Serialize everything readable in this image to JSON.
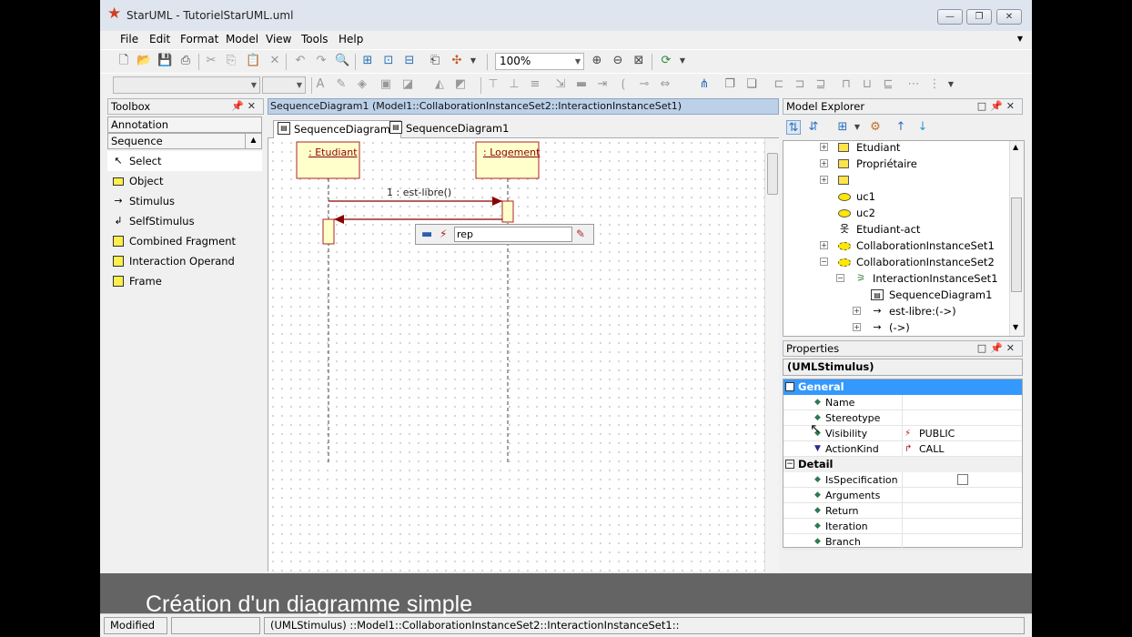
{
  "window": {
    "title": "StarUML - TutorielStarUML.uml",
    "buttons": [
      "minimize",
      "maximize",
      "close"
    ]
  },
  "menu": {
    "items": [
      "File",
      "Edit",
      "Format",
      "Model",
      "View",
      "Tools",
      "Help"
    ]
  },
  "toolbar": {
    "zoom_value": "100%"
  },
  "toolbox": {
    "title": "Toolbox",
    "categories": [
      "Annotation",
      "Sequence"
    ],
    "items": [
      {
        "label": "Select",
        "icon": "cursor-icon",
        "selected": true
      },
      {
        "label": "Object",
        "icon": "object-icon"
      },
      {
        "label": "Stimulus",
        "icon": "arrow-right-icon"
      },
      {
        "label": "SelfStimulus",
        "icon": "self-arrow-icon"
      },
      {
        "label": "Combined Fragment",
        "icon": "fragment-icon"
      },
      {
        "label": "Interaction Operand",
        "icon": "operand-icon"
      },
      {
        "label": "Frame",
        "icon": "frame-icon"
      }
    ]
  },
  "diagram": {
    "path": "SequenceDiagram1 (Model1::CollaborationInstanceSet2::InteractionInstanceSet1)",
    "tabs": [
      "SequenceDiagram1",
      "SequenceDiagram1"
    ],
    "objects": [
      {
        "label": ": Etudiant"
      },
      {
        "label": ": Logement"
      }
    ],
    "messages": [
      {
        "label": "1 : est-libre()"
      }
    ],
    "editor": {
      "value": "rep"
    }
  },
  "explorer": {
    "title": "Model Explorer",
    "nodes": [
      {
        "label": "Etudiant",
        "icon": "class-icon"
      },
      {
        "label": "Propriétaire",
        "icon": "class-icon"
      },
      {
        "label": "",
        "icon": "class-icon"
      },
      {
        "label": "uc1",
        "icon": "usecase-icon"
      },
      {
        "label": "uc2",
        "icon": "usecase-icon"
      },
      {
        "label": "Etudiant-act",
        "icon": "actor-icon"
      },
      {
        "label": "CollaborationInstanceSet1",
        "icon": "collaboration-icon"
      },
      {
        "label": "CollaborationInstanceSet2",
        "icon": "collaboration-icon"
      },
      {
        "label": "InteractionInstanceSet1",
        "icon": "interaction-icon"
      },
      {
        "label": "SequenceDiagram1",
        "icon": "diagram-icon"
      },
      {
        "label": "est-libre:(->)",
        "icon": "stimulus-icon"
      },
      {
        "label": "(->)",
        "icon": "stimulus-icon"
      }
    ]
  },
  "properties": {
    "title": "Properties",
    "type": "(UMLStimulus)",
    "categories": [
      {
        "name": "General",
        "rows": [
          {
            "name": "Name",
            "value": ""
          },
          {
            "name": "Stereotype",
            "value": ""
          },
          {
            "name": "Visibility",
            "value": "PUBLIC"
          },
          {
            "name": "ActionKind",
            "value": "CALL"
          }
        ]
      },
      {
        "name": "Detail",
        "rows": [
          {
            "name": "IsSpecification",
            "value": ""
          },
          {
            "name": "Arguments",
            "value": ""
          },
          {
            "name": "Return",
            "value": ""
          },
          {
            "name": "Iteration",
            "value": ""
          },
          {
            "name": "Branch",
            "value": ""
          }
        ]
      }
    ]
  },
  "statusbar": {
    "mode": "Modified",
    "path": "(UMLStimulus) ::Model1::CollaborationInstanceSet2::InteractionInstanceSet1::"
  },
  "caption": "Création d'un diagramme simple"
}
